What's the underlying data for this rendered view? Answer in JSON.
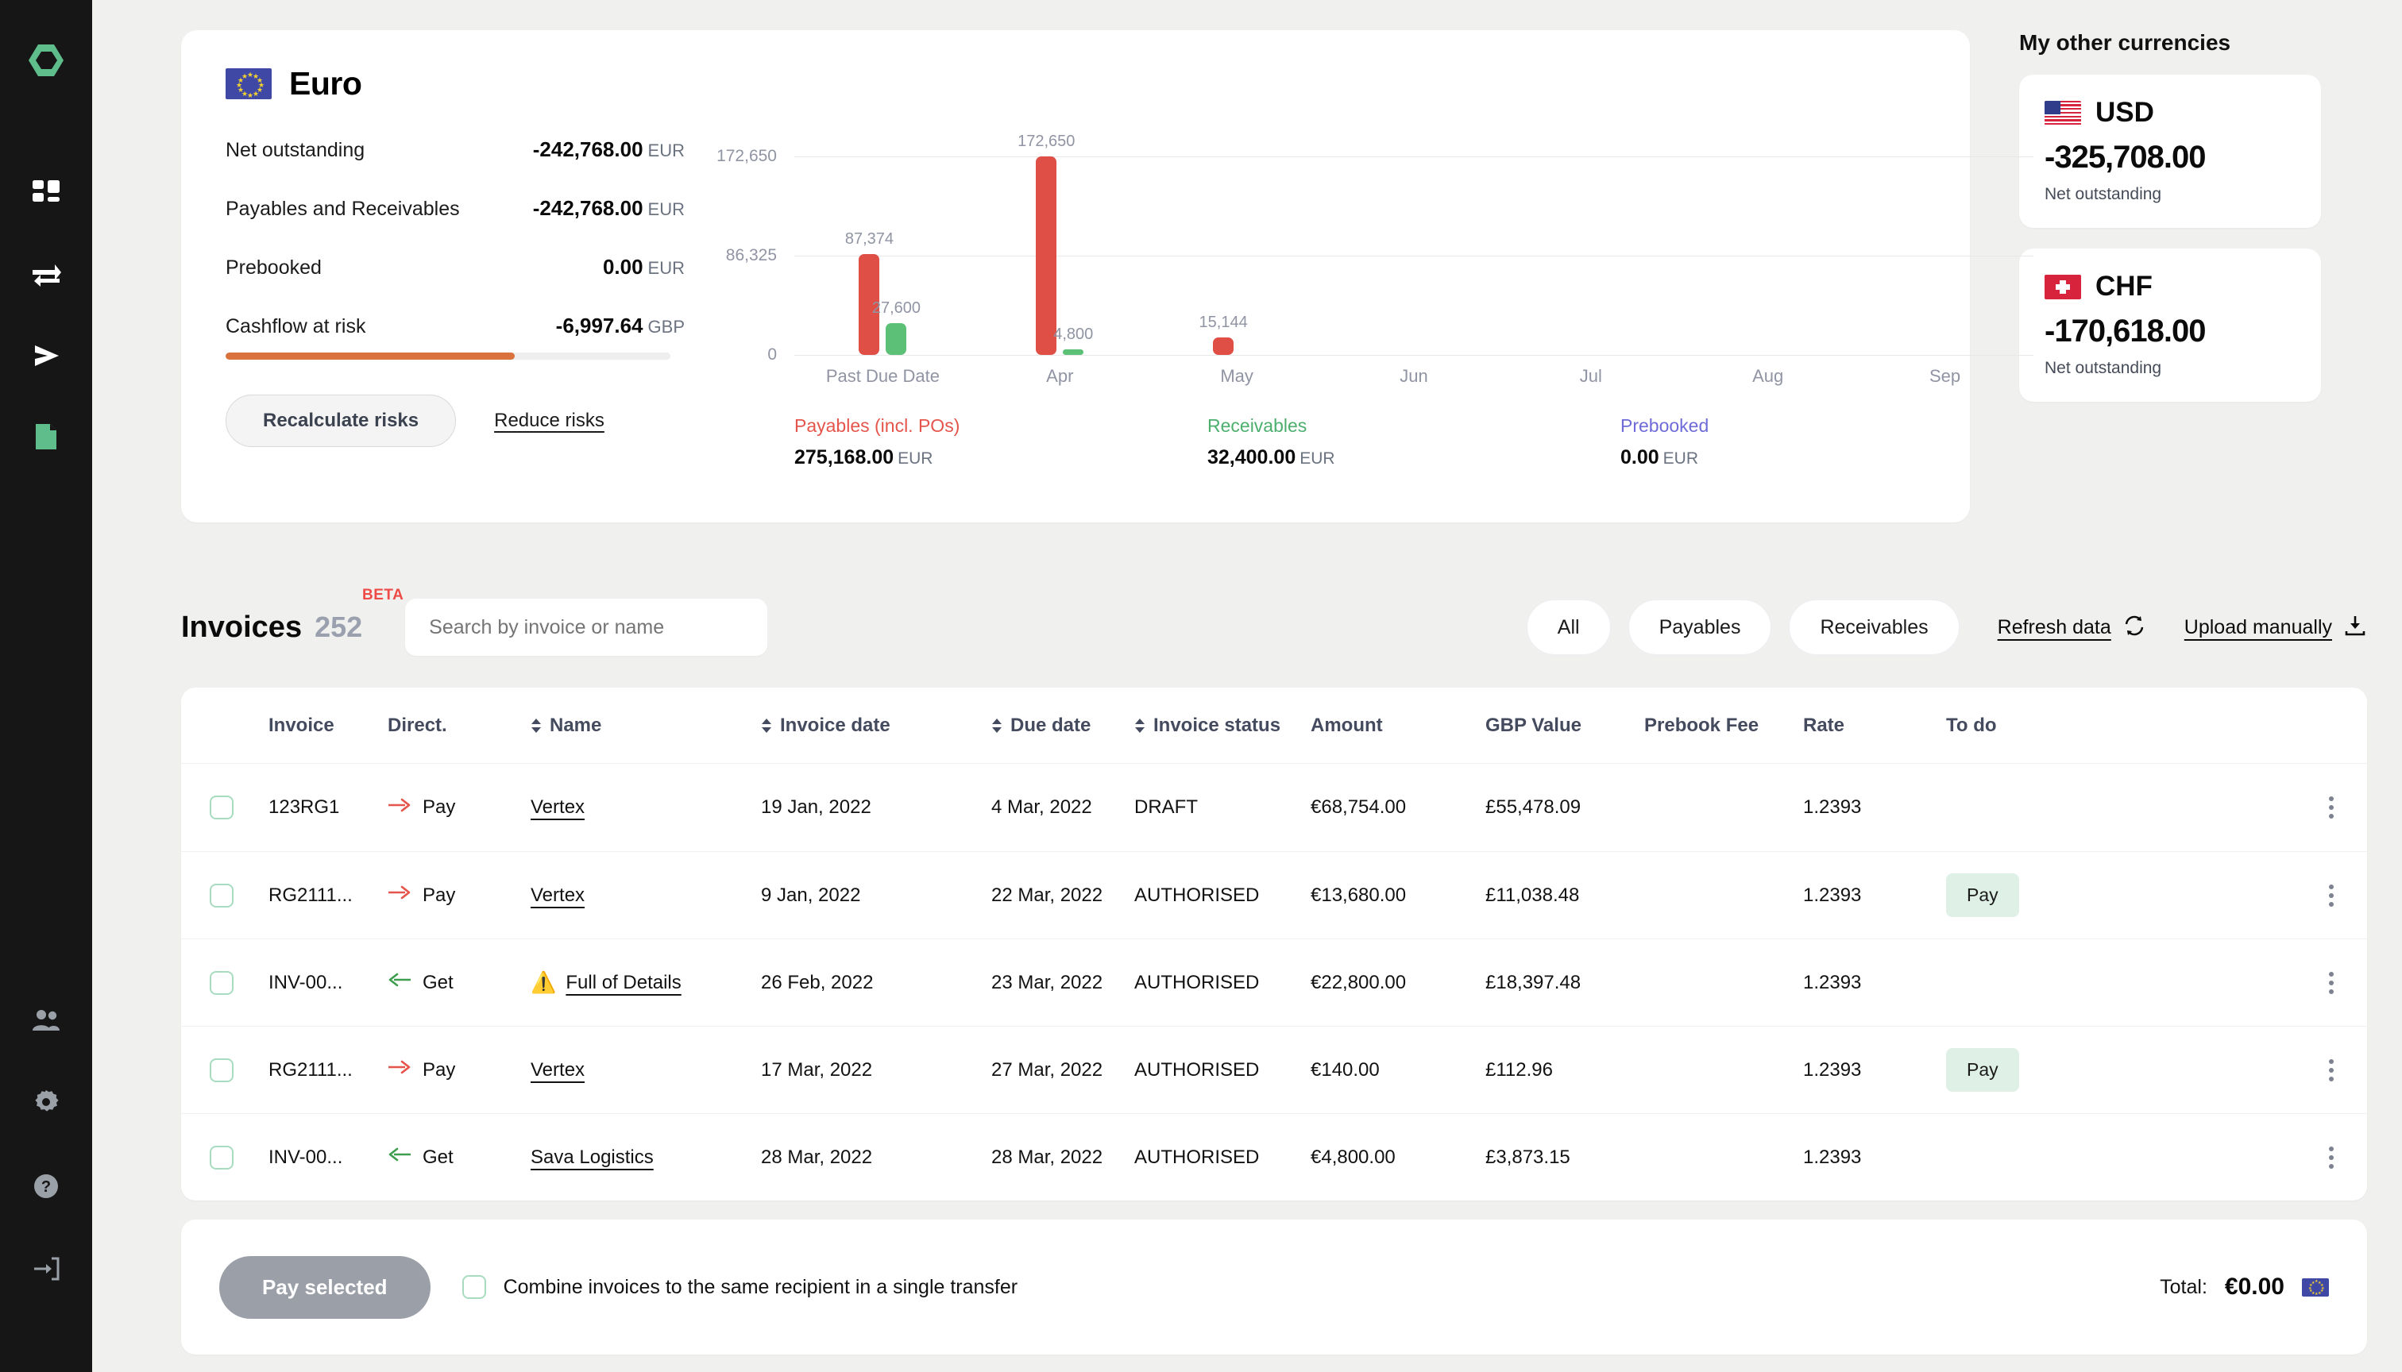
{
  "sidebar": {
    "logo_icon": "hexagon-logo",
    "items": [
      {
        "icon": "dashboard-grid-icon",
        "name": "dashboard"
      },
      {
        "icon": "transfer-arrows-icon",
        "name": "transfers"
      },
      {
        "icon": "send-play-icon",
        "name": "send"
      },
      {
        "icon": "document-icon",
        "name": "invoices"
      }
    ],
    "bottom_items": [
      {
        "icon": "people-icon",
        "name": "contacts"
      },
      {
        "icon": "gear-icon",
        "name": "settings"
      },
      {
        "icon": "question-circle-icon",
        "name": "help"
      },
      {
        "icon": "logout-icon",
        "name": "logout"
      }
    ]
  },
  "euro_card": {
    "flag_icon": "eu-flag",
    "title": "Euro",
    "stats": [
      {
        "label": "Net outstanding",
        "value": "-242,768.00",
        "currency": "EUR"
      },
      {
        "label": "Payables and Receivables",
        "value": "-242,768.00",
        "currency": "EUR"
      },
      {
        "label": "Prebooked",
        "value": "0.00",
        "currency": "EUR"
      },
      {
        "label": "Cashflow at risk",
        "value": "-6,997.64",
        "currency": "GBP"
      }
    ],
    "risk_bar_percent": 65,
    "risk_bar_color": "#d9723c",
    "recalculate_label": "Recalculate risks",
    "reduce_label": "Reduce risks"
  },
  "chart_data": {
    "type": "bar",
    "title": "",
    "categories": [
      "Past Due Date",
      "Apr",
      "May",
      "Jun",
      "Jul",
      "Aug",
      "Sep"
    ],
    "series": [
      {
        "name": "Payables (incl. POs)",
        "color": "#df4f46",
        "values": [
          87374,
          172650,
          15144,
          0,
          0,
          0,
          0
        ]
      },
      {
        "name": "Receivables",
        "color": "#5cc077",
        "values": [
          27600,
          4800,
          0,
          0,
          0,
          0,
          0
        ]
      }
    ],
    "bar_labels": [
      {
        "text": "87,374",
        "series": "Payables (incl. POs)",
        "category": "Past Due Date"
      },
      {
        "text": "27,600",
        "series": "Receivables",
        "category": "Past Due Date"
      },
      {
        "text": "172,650",
        "series": "Payables (incl. POs)",
        "category": "Apr"
      },
      {
        "text": "4,800",
        "series": "Receivables",
        "category": "Apr"
      },
      {
        "text": "15,144",
        "series": "Payables (incl. POs)",
        "category": "May"
      }
    ],
    "yticks": [
      "172,650",
      "86,325",
      "0"
    ],
    "ylim": [
      0,
      172650
    ],
    "xlabel": "",
    "ylabel": "",
    "grid": true,
    "legend_position": "bottom"
  },
  "chart_legend": [
    {
      "name": "Payables (incl. POs)",
      "value": "275,168.00",
      "currency": "EUR",
      "color": "#e5554b"
    },
    {
      "name": "Receivables",
      "value": "32,400.00",
      "currency": "EUR",
      "color": "#4caf6e"
    },
    {
      "name": "Prebooked",
      "value": "0.00",
      "currency": "EUR",
      "color": "#6e6bd9"
    }
  ],
  "currencies": {
    "heading": "My other currencies",
    "cards": [
      {
        "flag_icon": "us-flag",
        "code": "USD",
        "amount": "-325,708.00",
        "sub": "Net outstanding"
      },
      {
        "flag_icon": "ch-flag",
        "code": "CHF",
        "amount": "-170,618.00",
        "sub": "Net outstanding"
      }
    ]
  },
  "invoices": {
    "title": "Invoices",
    "count": "252",
    "badge": "BETA",
    "search_placeholder": "Search by invoice or name",
    "filters": [
      "All",
      "Payables",
      "Receivables"
    ],
    "refresh_label": "Refresh data",
    "refresh_icon": "refresh-icon",
    "upload_label": "Upload manually",
    "upload_icon": "download-upload-icon",
    "columns": [
      "Invoice",
      "Direct.",
      "Name",
      "Invoice date",
      "Due date",
      "Invoice status",
      "Amount",
      "GBP Value",
      "Prebook Fee",
      "Rate",
      "To do"
    ],
    "rows": [
      {
        "invoice": "123RG1",
        "direction": "Pay",
        "direction_icon": "arrow-right-icon",
        "name": "Vertex",
        "warn": false,
        "invoice_date": "19 Jan, 2022",
        "due_date": "4 Mar, 2022",
        "status": "DRAFT",
        "amount": "€68,754.00",
        "gbp": "£55,478.09",
        "fee": "",
        "rate": "1.2393",
        "todo": ""
      },
      {
        "invoice": "RG2111...",
        "direction": "Pay",
        "direction_icon": "arrow-right-icon",
        "name": "Vertex",
        "warn": false,
        "invoice_date": "9 Jan, 2022",
        "due_date": "22 Mar, 2022",
        "status": "AUTHORISED",
        "amount": "€13,680.00",
        "gbp": "£11,038.48",
        "fee": "",
        "rate": "1.2393",
        "todo": "Pay"
      },
      {
        "invoice": "INV-00...",
        "direction": "Get",
        "direction_icon": "arrow-left-icon",
        "name": "Full of Details",
        "warn": true,
        "invoice_date": "26 Feb, 2022",
        "due_date": "23 Mar, 2022",
        "status": "AUTHORISED",
        "amount": "€22,800.00",
        "gbp": "£18,397.48",
        "fee": "",
        "rate": "1.2393",
        "todo": ""
      },
      {
        "invoice": "RG2111...",
        "direction": "Pay",
        "direction_icon": "arrow-right-icon",
        "name": "Vertex",
        "warn": false,
        "invoice_date": "17 Mar, 2022",
        "due_date": "27 Mar, 2022",
        "status": "AUTHORISED",
        "amount": "€140.00",
        "gbp": "£112.96",
        "fee": "",
        "rate": "1.2393",
        "todo": "Pay"
      },
      {
        "invoice": "INV-00...",
        "direction": "Get",
        "direction_icon": "arrow-left-icon",
        "name": "Sava Logistics",
        "warn": false,
        "invoice_date": "28 Mar, 2022",
        "due_date": "28 Mar, 2022",
        "status": "AUTHORISED",
        "amount": "€4,800.00",
        "gbp": "£3,873.15",
        "fee": "",
        "rate": "1.2393",
        "todo": ""
      }
    ]
  },
  "footer": {
    "pay_selected_label": "Pay selected",
    "combine_label": "Combine invoices to the same recipient in a single transfer",
    "total_label": "Total:",
    "total_value": "€0.00",
    "total_flag_icon": "eu-flag"
  }
}
